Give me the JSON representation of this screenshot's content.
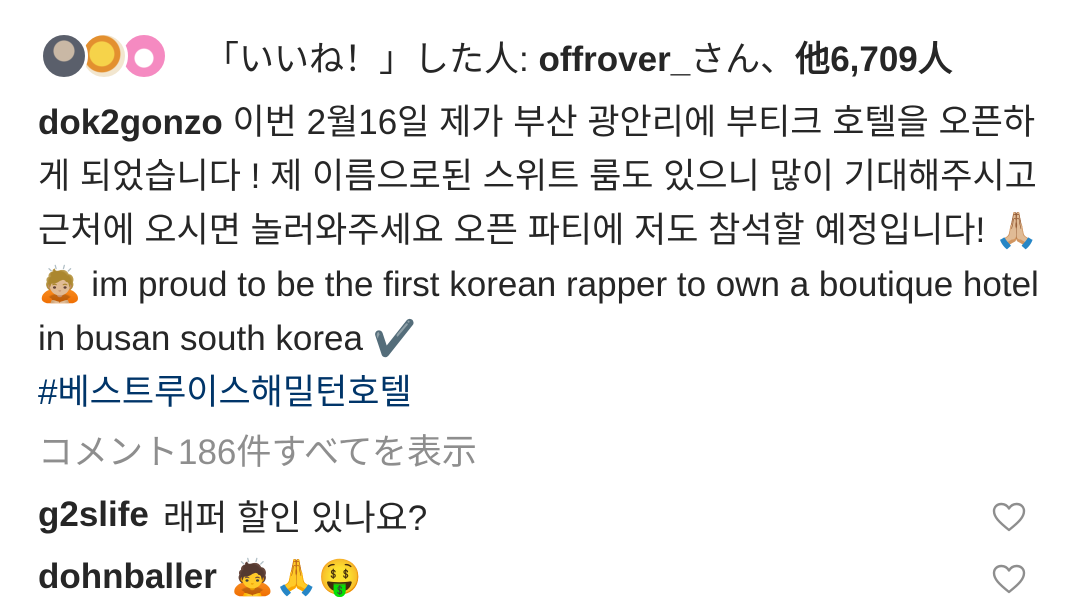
{
  "likes": {
    "prefix": "「いいね！」した人: ",
    "user": "offrover_",
    "middle": "さん、",
    "others": "他6,709人"
  },
  "post": {
    "username": "dok2gonzo",
    "caption": "이번 2월16일 제가 부산 광안리에 부티크 호텔을 오픈하게 되었습니다 ! 제 이름으로된 스위트 룸도 있으니 많이 기대해주시고 근처에 오시면 놀러와주세요 오픈 파티에 저도 참석할 예정입니다! 🙏🏼🙇🏼 im proud to be the first korean rapper to own a boutique hotel in busan south korea ✔️",
    "hashtag": "#베스트루이스해밀턴호텔"
  },
  "view_comments": "コメント186件すべてを表示",
  "comments": [
    {
      "user": "g2slife",
      "text": "래퍼 할인 있나요?",
      "like_icon": "heart-outline-icon"
    },
    {
      "user": "dohnballer",
      "text": "🙇🙏🤑",
      "like_icon": "heart-outline-icon"
    }
  ],
  "colors": {
    "text": "#262626",
    "hashtag": "#003569",
    "muted": "#8e8e8e"
  }
}
